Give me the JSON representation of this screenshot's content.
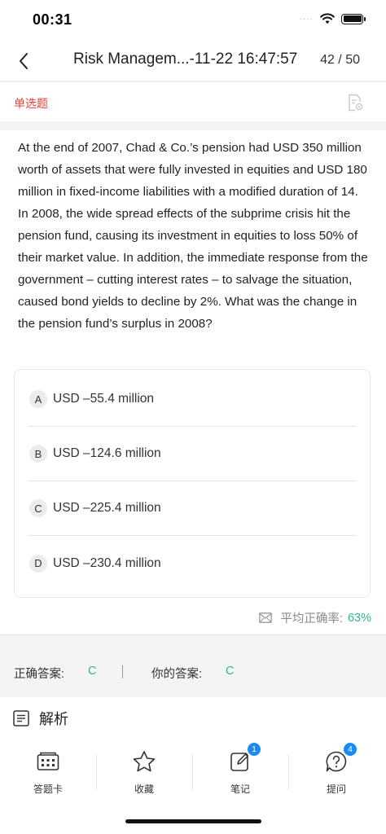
{
  "status": {
    "time": "00:31",
    "signal": "····"
  },
  "nav": {
    "title": "Risk Managem...-11-22 16:47:57",
    "progress": "42 / 50"
  },
  "question": {
    "type_label": "单选题",
    "text": "At the end of 2007, Chad & Co.’s pension had USD 350 million worth of assets that were fully invested in equities and USD 180 million in fixed-income liabilities with a modified duration of 14. In 2008, the wide spread effects of the subprime crisis hit the pension fund, causing its investment in equities to loss 50% of their market value. In addition, the immediate response from the government – cutting interest rates – to salvage the situation, caused bond yields to decline by 2%. What was the change in the pension fund’s surplus in 2008?",
    "options": [
      {
        "letter": "A",
        "text": "USD –55.4 million"
      },
      {
        "letter": "B",
        "text": "USD –124.6 million"
      },
      {
        "letter": "C",
        "text": "USD –225.4 million"
      },
      {
        "letter": "D",
        "text": "USD –230.4 million"
      }
    ]
  },
  "stats": {
    "accuracy_label": "平均正确率:",
    "accuracy_value": "63%"
  },
  "answers": {
    "correct_label": "正确答案:",
    "correct_value": "C",
    "yours_label": "你的答案:",
    "yours_value": "C"
  },
  "analysis": {
    "label": "解析"
  },
  "tabbar": {
    "items": [
      {
        "label": "答题卡",
        "icon": "answer-card-icon",
        "badge": ""
      },
      {
        "label": "收藏",
        "icon": "star-icon",
        "badge": ""
      },
      {
        "label": "笔记",
        "icon": "note-edit-icon",
        "badge": "1"
      },
      {
        "label": "提问",
        "icon": "question-bubble-icon",
        "badge": "4"
      }
    ]
  },
  "colors": {
    "accent_red": "#e0463b",
    "correct_green": "#2fb98c",
    "badge_blue": "#1a8cf0"
  }
}
